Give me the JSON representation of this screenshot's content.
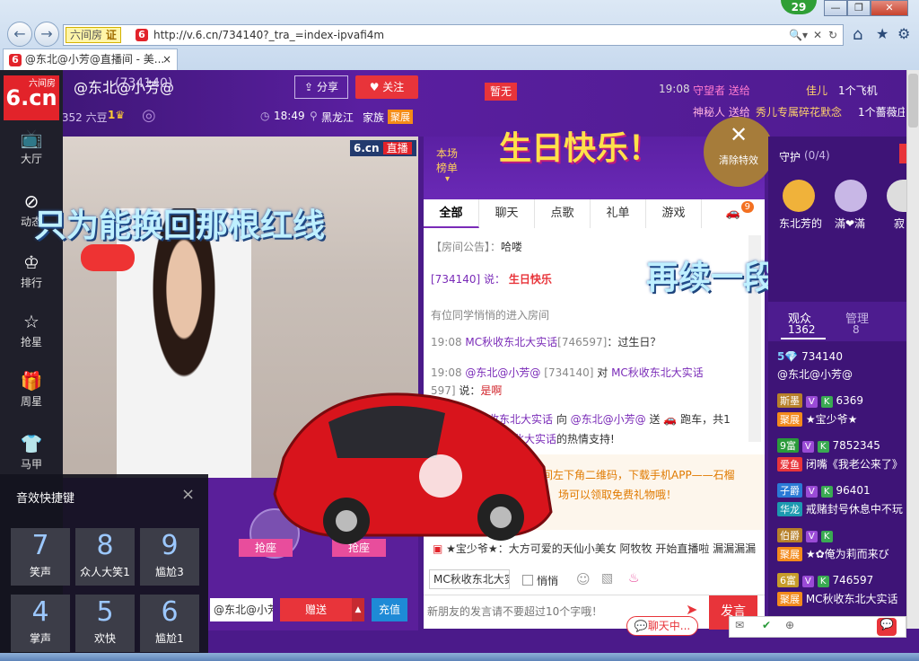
{
  "browser": {
    "back_label": "←",
    "forward_label": "→",
    "site_badge": "六间房",
    "cert_label": "证",
    "url": "http://v.6.cn/734140?_tra_=index-ipvafi4m",
    "tab_title": "@东北@小芳@直播间 - 美...",
    "tab_close": "×",
    "ie_badge": "29",
    "min": "—",
    "max": "❐",
    "close": "✕",
    "home": "⌂",
    "star": "★",
    "gear": "⚙"
  },
  "header": {
    "logo": "6.cn",
    "logo_small": "六间房",
    "room_title": "@东北@小芳@",
    "room_id": "(734140)",
    "rank": "5",
    "beans": "330352 六豆",
    "level": "1",
    "share_label": "分享",
    "follow_label": "关注",
    "time": "18:49",
    "location": "黑龙江",
    "family_label": "家族",
    "family_name": "聚展",
    "anchor_label": "暂无"
  },
  "ticker": [
    {
      "time": "19:08",
      "text": "守望者 送给",
      "to": "佳儿",
      "gift": "1个飞机"
    },
    {
      "time": "",
      "text": "神秘人 送给",
      "to": "秀儿专属碎花默念",
      "gift": "1个薔薇庄园"
    }
  ],
  "banner": {
    "text": "生日快乐！",
    "close_effects": "清除特效",
    "guard": "守护",
    "guard_count": "(0/4)"
  },
  "sidebar": [
    {
      "label": "大厅",
      "icon": "tv-icon"
    },
    {
      "label": "动态",
      "icon": "compass-icon"
    },
    {
      "label": "排行",
      "icon": "crown-icon"
    },
    {
      "label": "抢星",
      "icon": "star-icon"
    },
    {
      "label": "周星",
      "icon": "gift-icon"
    },
    {
      "label": "马甲",
      "icon": "shirt-icon"
    }
  ],
  "video": {
    "watermark": "6.cn",
    "live_badge": "直播",
    "caption": "只为能换回那根红线",
    "seat_label_1": "抢座",
    "seat_label_2": "抢座",
    "send_to": "@东北@小芳",
    "send_btn": "赠送",
    "recharge_btn": "充值"
  },
  "chat": {
    "rank_label_1": "本场",
    "rank_label_2": "榜单",
    "tabs": [
      "全部",
      "聊天",
      "点歌",
      "礼单",
      "游戏"
    ],
    "car_badge": "9",
    "notice_label": "【房间公告】：",
    "notice_text": "哈喽",
    "msg1_user": "[734140] 说：",
    "msg1_text": "生日快乐",
    "msg2": "有位同学悄悄的进入房间",
    "msg3_time": "19:08",
    "msg3_user": "MC秋收东北大实话",
    "msg3_id": "[746597]",
    "msg3_text": "：过生日？",
    "msg4_time": "19:08",
    "msg4_user": "@东北@小芳@",
    "msg4_id": "[734140]",
    "msg4_mid": " 对 ",
    "msg4_to": "MC秋收东北大实话",
    "msg4b_id": "597]",
    "msg4b_say": " 说：",
    "msg4b_text": "是啊",
    "msg5_user": "收东北大实话",
    "msg5_mid": " 向 ",
    "msg5_to": "@东北@小芳@",
    "msg5_send": " 送",
    "msg5_gift": "跑车，共1",
    "msg5b_user": "北大实话",
    "msg5b_text": "的热情支持!",
    "overlay_text": "再续一段情缘",
    "promo1": "房间左下角二维码，下载手机APP——石榴",
    "promo2": "场可以领取免费礼物哦！",
    "system_line": "★宝少爷★：大方可爱的天仙小美女 阿牧牧 开始直播啦 漏漏漏漏",
    "target_select": "MC秋收东北大实",
    "whisper_label": "悄悄",
    "input_placeholder": "新朋友的发言请不要超过10个字哦！",
    "send_label": "发言",
    "chatting_label": "聊天中..."
  },
  "right": {
    "tab_viewers": "观众",
    "viewers_count": "1362",
    "tab_admins": "管理",
    "admins_count": "8",
    "guard_name_1": "东北芳的",
    "guard_name_2": "滿❤滿",
    "guard_name_3": "寂",
    "users": [
      {
        "badge": "5",
        "id": "734140",
        "name": "@东北@小芳@"
      },
      {
        "badge": "斯墨",
        "id": "6369",
        "name": "★宝少爷★",
        "lvl": "聚展"
      },
      {
        "badge": "9富",
        "id": "7852345",
        "name": "闭嘴《我老公来了》",
        "lvl": "爱鱼"
      },
      {
        "badge": "子爵",
        "id": "96401",
        "name": "戒赌封号休息中不玩",
        "lvl": "华龙"
      },
      {
        "badge": "伯爵",
        "id": "",
        "name": "★✿俺为莉而来び",
        "lvl": "聚展"
      },
      {
        "badge": "6富",
        "id": "746597",
        "name": "MC秋收东北大实话",
        "lvl": "聚展"
      }
    ]
  },
  "sfx": {
    "title": "音效快捷键",
    "close": "×",
    "keys": [
      {
        "n": "7",
        "l": "笑声"
      },
      {
        "n": "8",
        "l": "众人大笑1"
      },
      {
        "n": "9",
        "l": "尴尬3"
      },
      {
        "n": "4",
        "l": "掌声"
      },
      {
        "n": "5",
        "l": "欢快"
      },
      {
        "n": "6",
        "l": "尴尬1"
      }
    ]
  }
}
